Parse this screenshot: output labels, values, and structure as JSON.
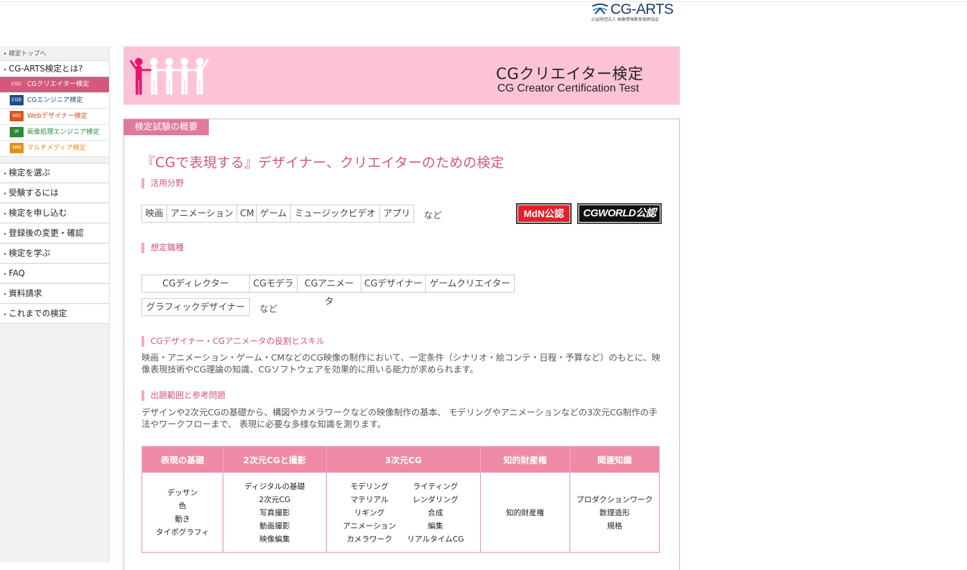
{
  "logo": {
    "name": "CG-ARTS",
    "sub": "公益財団法人 画像情報教育振興協会"
  },
  "sidebar": {
    "top_link": "検定トップへ",
    "heading": "CG-ARTS検定とは?",
    "sub_items": [
      {
        "badge": "CGC",
        "label": "CGクリエイター検定",
        "color": "#d4587c"
      },
      {
        "badge": "CGE",
        "label": "CGエンジニア検定",
        "color": "#1f4e8c"
      },
      {
        "badge": "WD",
        "label": "Webデザイナー検定",
        "color": "#d9531e"
      },
      {
        "badge": "IP",
        "label": "画像処理エンジニア検定",
        "color": "#2e8b3a"
      },
      {
        "badge": "MM",
        "label": "マルチメディア検定",
        "color": "#e0901b"
      }
    ],
    "nav": [
      "検定を選ぶ",
      "受験するには",
      "検定を申し込む",
      "登録後の変更・確認",
      "検定を学ぶ",
      "FAQ",
      "資料請求",
      "これまでの検定"
    ]
  },
  "banner": {
    "title_jp": "CGクリエイター検定",
    "title_en": "CG Creator Certification Test"
  },
  "section_tab": "検定試験の概要",
  "headline": "『CGで表現する』デザイナー、クリエイターのための検定",
  "fields": {
    "title": "活用分野",
    "items": [
      "映画",
      "アニメーション",
      "CM",
      "ゲーム",
      "ミュージックビデオ",
      "アプリ"
    ],
    "etc": "など",
    "badge_mdn": "MdN公認",
    "badge_cgworld": "CGWORLD公認"
  },
  "jobs": {
    "title": "想定職種",
    "row1": [
      "CGディレクター",
      "CGモデラ",
      "CGアニメータ",
      "CGデザイナー",
      "ゲームクリエイター"
    ],
    "row2": [
      "グラフィックデザイナー"
    ],
    "etc": "など"
  },
  "roles": {
    "title": "CGデザイナー・CGアニメータの役割とスキル",
    "text": "映画・アニメーション・ゲーム・CMなどのCG映像の制作において、一定条件（シナリオ・絵コンテ・日程・予算など）のもとに、映像表現技術やCG理論の知識、CGソフトウェアを効果的に用いる能力が求められます。"
  },
  "scope": {
    "title": "出題範囲と参考問題",
    "text": "デザインや2次元CGの基礎から、構図やカメラワークなどの映像制作の基本、 モデリングやアニメーションなどの3次元CG制作の手法やワークフローまで、 表現に必要な多様な知識を測ります。",
    "headers": [
      "表現の基礎",
      "2次元CGと撮影",
      "3次元CG",
      "知的財産権",
      "関連知識"
    ],
    "col1": [
      "デッサン",
      "色",
      "動き",
      "タイポグラフィ"
    ],
    "col2": [
      "ディジタルの基礎",
      "2次元CG",
      "写真撮影",
      "動画撮影",
      "映像編集"
    ],
    "col3": [
      "モデリング",
      "ライティング",
      "マテリアル",
      "レンダリング",
      "リギング",
      "合成",
      "アニメーション",
      "編集",
      "カメラワーク",
      "リアルタイムCG"
    ],
    "col4": [
      "知的財産権"
    ],
    "col5": [
      "プロダクションワーク",
      "数理造形",
      "規格"
    ]
  }
}
